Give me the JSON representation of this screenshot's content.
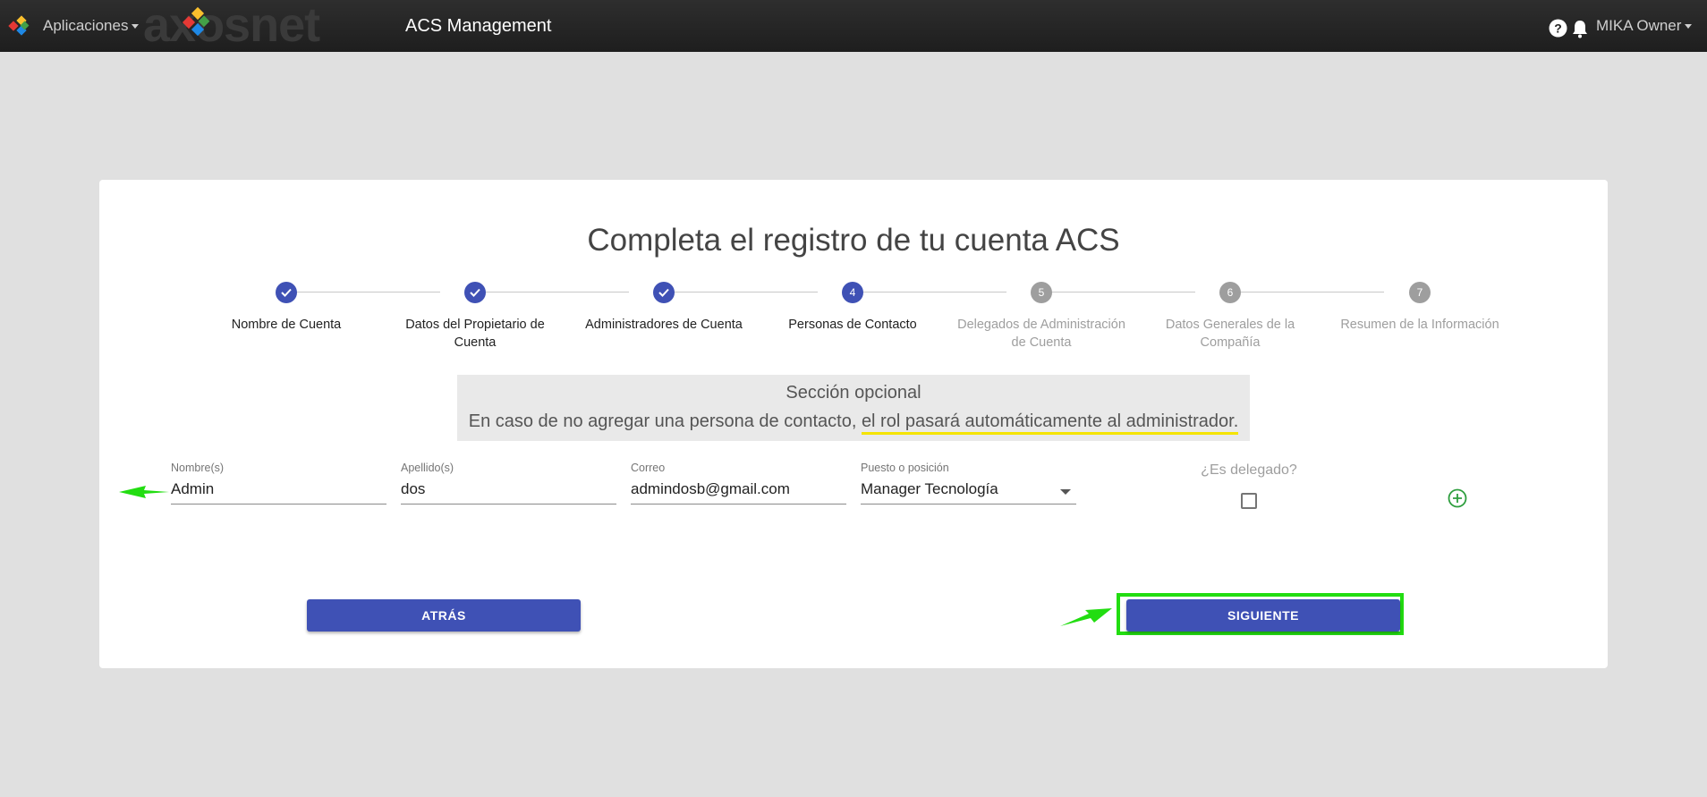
{
  "topbar": {
    "apps_label": "Aplicaciones",
    "brand_text": "axosnet",
    "app_title": "ACS Management",
    "user_label": "MIKA Owner",
    "icons": [
      "apps-logo-icon",
      "help-icon",
      "bell-icon"
    ]
  },
  "card": {
    "title": "Completa el registro de tu cuenta ACS"
  },
  "stepper": {
    "steps": [
      {
        "number": "1",
        "label": "Nombre de Cuenta",
        "state": "done"
      },
      {
        "number": "2",
        "label": "Datos del Propietario de Cuenta",
        "state": "done"
      },
      {
        "number": "3",
        "label": "Administradores de Cuenta",
        "state": "done"
      },
      {
        "number": "4",
        "label": "Personas de Contacto",
        "state": "active"
      },
      {
        "number": "5",
        "label": "Delegados de Administración de Cuenta",
        "state": "pending"
      },
      {
        "number": "6",
        "label": "Datos Generales de la Compañía",
        "state": "pending"
      },
      {
        "number": "7",
        "label": "Resumen de la Información",
        "state": "pending"
      }
    ],
    "colors": {
      "active": "#3f51b5",
      "pending": "#9e9e9e"
    }
  },
  "notice": {
    "title": "Sección opcional",
    "text_plain": "En caso de no agregar una persona de contacto, ",
    "text_highlight": "el rol pasará automáticamente al administrador."
  },
  "form": {
    "nombre": {
      "label": "Nombre(s)",
      "value": "Admin"
    },
    "apellido": {
      "label": "Apellido(s)",
      "value": "dos"
    },
    "correo": {
      "label": "Correo",
      "value": "admindosb@gmail.com"
    },
    "puesto": {
      "label": "Puesto o posición",
      "value": "Manager Tecnología"
    },
    "delegado": {
      "label": "¿Es delegado?",
      "checked": false
    }
  },
  "buttons": {
    "back": "ATRÁS",
    "next": "SIGUIENTE"
  },
  "colors": {
    "primary": "#3f51b5",
    "annotation_green": "#22dd11",
    "highlight_yellow": "#f5e400",
    "add_icon_green": "#2e9e3e"
  }
}
